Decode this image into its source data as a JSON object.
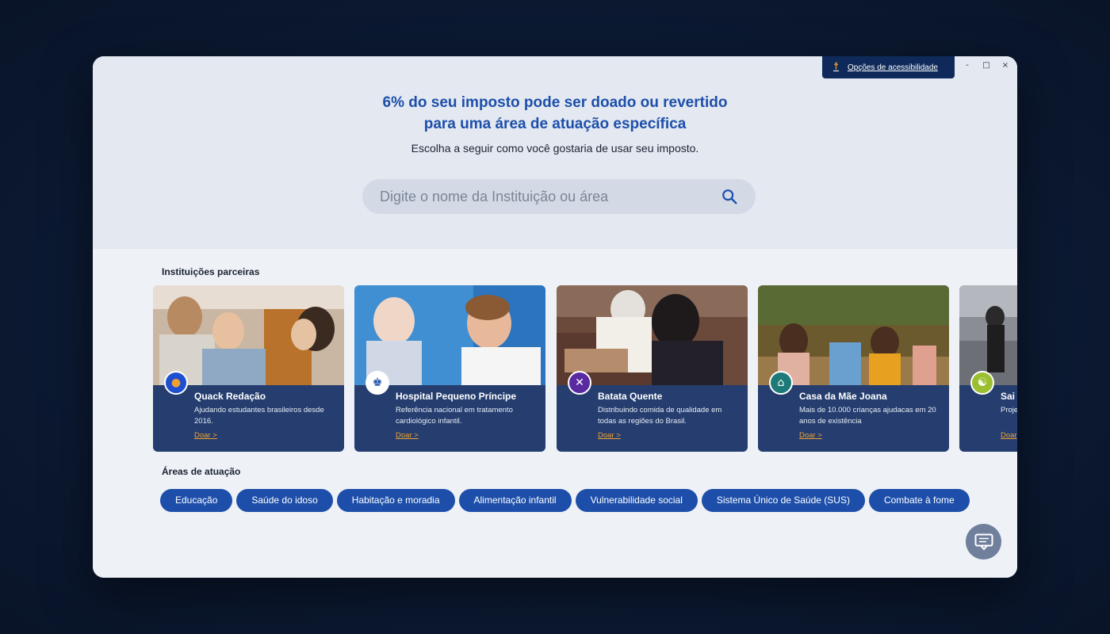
{
  "window": {
    "controls": {
      "minimize": "-",
      "maximize": "□",
      "close": "×"
    },
    "accessibility_label": "Opções de acessibilidade"
  },
  "hero": {
    "headline_line1": "6% do seu imposto pode ser doado ou revertido",
    "headline_line2": "para uma área de atuação específica",
    "subhead": "Escolha a seguir como você gostaria de usar seu imposto.",
    "search_placeholder": "Digite o nome da Instituição ou área"
  },
  "partners": {
    "title": "Instituições parceiras",
    "cards": [
      {
        "name": "Quack Redação",
        "desc": "Ajudando estudantes brasileiros desde 2016.",
        "cta": "Doar >",
        "logo_color": "#1d4fd0",
        "logo_icon": "duck-icon",
        "logo_glyph": "●"
      },
      {
        "name": "Hospital Pequeno Príncipe",
        "desc": "Referência nacional em tratamento cardiológico infantil.",
        "cta": "Doar >",
        "logo_color": "#ffffff",
        "logo_icon": "prince-icon",
        "logo_glyph": "♚"
      },
      {
        "name": "Batata Quente",
        "desc": "Distribuindo comida de qualidade em todas as regiões do Brasil.",
        "cta": "Doar >",
        "logo_color": "#5a2aa0",
        "logo_icon": "fork-knife-icon",
        "logo_glyph": "✕"
      },
      {
        "name": "Casa da Mãe Joana",
        "desc": "Mais de 10.000 crianças ajudacas em 20 anos de existência",
        "cta": "Doar >",
        "logo_color": "#1d7a78",
        "logo_icon": "house-icon",
        "logo_glyph": "⌂"
      },
      {
        "name": "Sai",
        "desc": "Proje vulne",
        "cta": "Doar",
        "logo_color": "#9abf30",
        "logo_icon": "meditation-icon",
        "logo_glyph": "☯"
      }
    ]
  },
  "areas": {
    "title": "Áreas de atuação",
    "chips": [
      "Educação",
      "Saúde do idoso",
      "Habitação e moradia",
      "Alimentação infantil",
      "Vulnerabilidade social",
      "Sistema Único de Saúde (SUS)",
      "Combate à fome"
    ]
  },
  "colors": {
    "accent": "#1d4faa",
    "cta": "#f0a030",
    "panel": "#163064"
  }
}
